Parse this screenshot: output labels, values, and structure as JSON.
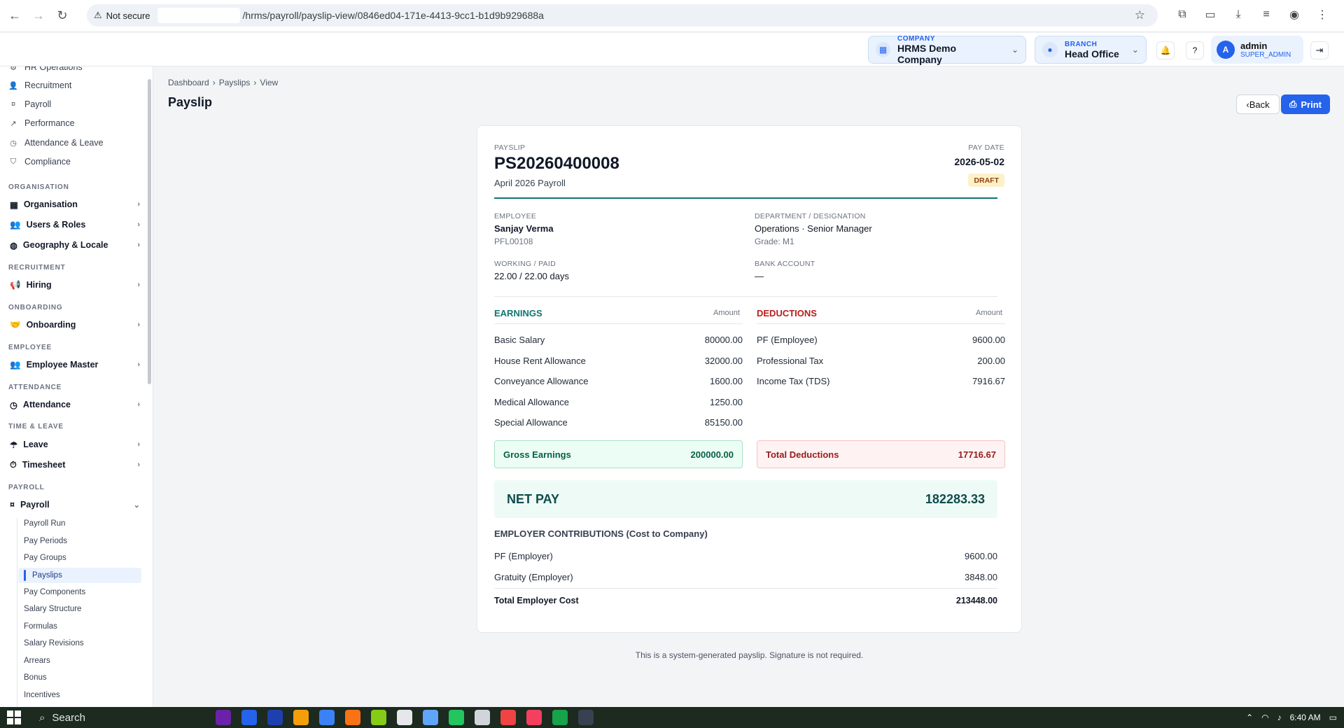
{
  "browser": {
    "security_label": "Not secure",
    "url": "/hrms/payroll/payslip-view/0846ed04-171e-4413-9cc1-b1d9b929688a"
  },
  "header": {
    "company_label": "COMPANY",
    "company_value": "HRMS Demo Company",
    "branch_label": "BRANCH",
    "branch_value": "Head Office",
    "user_initial": "A",
    "user_name": "admin",
    "user_role": "SUPER_ADMIN"
  },
  "sidebar": {
    "top_items": [
      {
        "label": "HR Operations",
        "icon": "gear-icon"
      },
      {
        "label": "Recruitment",
        "icon": "user-plus-icon"
      },
      {
        "label": "Payroll",
        "icon": "payroll-icon"
      },
      {
        "label": "Performance",
        "icon": "chart-icon"
      },
      {
        "label": "Attendance & Leave",
        "icon": "clock-icon"
      },
      {
        "label": "Compliance",
        "icon": "shield-icon"
      }
    ],
    "groups": {
      "organisation": "ORGANISATION",
      "recruitment": "RECRUITMENT",
      "onboarding": "ONBOARDING",
      "employee": "EMPLOYEE",
      "attendance": "ATTENDANCE",
      "time_leave": "TIME & LEAVE",
      "payroll": "PAYROLL"
    },
    "nodes": {
      "organisation": "Organisation",
      "users_roles": "Users & Roles",
      "geography": "Geography & Locale",
      "hiring": "Hiring",
      "onboarding": "Onboarding",
      "employee_master": "Employee Master",
      "attendance": "Attendance",
      "leave": "Leave",
      "timesheet": "Timesheet",
      "payroll": "Payroll"
    },
    "payroll_sub": [
      "Payroll Run",
      "Pay Periods",
      "Pay Groups",
      "Payslips",
      "Pay Components",
      "Salary Structure",
      "Formulas",
      "Salary Revisions",
      "Arrears",
      "Bonus",
      "Incentives"
    ]
  },
  "breadcrumb": [
    "Dashboard",
    "Payslips",
    "View"
  ],
  "page": {
    "title": "Payslip",
    "back_label": "Back",
    "print_label": "Print"
  },
  "payslip": {
    "label": "PAYSLIP",
    "number": "PS20260400008",
    "period": "April 2026 Payroll",
    "pay_date_label": "PAY DATE",
    "pay_date": "2026-05-02",
    "status": "DRAFT",
    "employee_label": "EMPLOYEE",
    "employee_name": "Sanjay Verma",
    "employee_code": "PFL00108",
    "dept_label": "DEPARTMENT / DESIGNATION",
    "dept_value": "Operations · Senior Manager",
    "grade": "Grade: M1",
    "working_label": "WORKING / PAID",
    "working_value": "22.00 / 22.00 days",
    "bank_label": "BANK ACCOUNT",
    "bank_value": "—",
    "earnings_title": "EARNINGS",
    "deductions_title": "DEDUCTIONS",
    "amount_label": "Amount",
    "earnings": [
      {
        "name": "Basic Salary",
        "amount": "80000.00"
      },
      {
        "name": "House Rent Allowance",
        "amount": "32000.00"
      },
      {
        "name": "Conveyance Allowance",
        "amount": "1600.00"
      },
      {
        "name": "Medical Allowance",
        "amount": "1250.00"
      },
      {
        "name": "Special Allowance",
        "amount": "85150.00"
      }
    ],
    "deductions": [
      {
        "name": "PF (Employee)",
        "amount": "9600.00"
      },
      {
        "name": "Professional Tax",
        "amount": "200.00"
      },
      {
        "name": "Income Tax (TDS)",
        "amount": "7916.67"
      }
    ],
    "gross_label": "Gross Earnings",
    "gross_value": "200000.00",
    "total_ded_label": "Total Deductions",
    "total_ded_value": "17716.67",
    "net_label": "NET PAY",
    "net_value": "182283.33",
    "contrib_title": "EMPLOYER CONTRIBUTIONS (Cost to Company)",
    "contributions": [
      {
        "name": "PF (Employer)",
        "amount": "9600.00"
      },
      {
        "name": "Gratuity (Employer)",
        "amount": "3848.00"
      }
    ],
    "total_employer_label": "Total Employer Cost",
    "total_employer_value": "213448.00",
    "footnote": "This is a system-generated payslip. Signature is not required."
  },
  "taskbar": {
    "search_placeholder": "Search",
    "time": "6:40 AM"
  },
  "colors": {
    "accent": "#2563eb",
    "earnings": "#0f766e",
    "deductions": "#b91c1c"
  }
}
